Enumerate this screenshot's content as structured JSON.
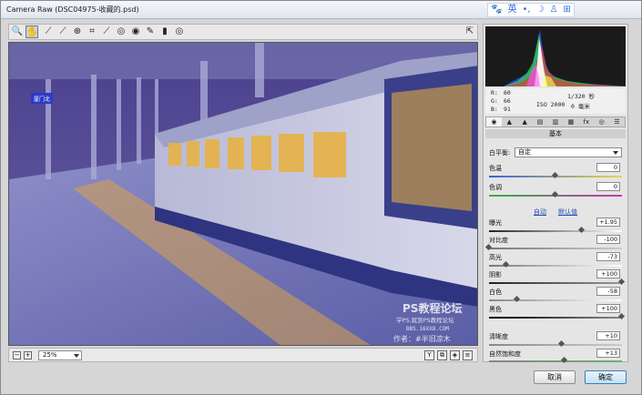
{
  "window": {
    "title": "Camera Raw (DSC04975-收藏的.psd)"
  },
  "ime": {
    "items": [
      "🐾",
      "英",
      "•,",
      "☽",
      "♙",
      "⊞"
    ]
  },
  "toolbar": {
    "tools": [
      "zoom-icon",
      "hand-icon",
      "white-balance-icon",
      "color-sampler-icon",
      "target-adjust-icon",
      "crop-icon",
      "straighten-icon",
      "spot-removal-icon",
      "red-eye-icon",
      "adjustment-brush-icon",
      "graduated-filter-icon",
      "radial-filter-icon"
    ],
    "glyphs": [
      "🔍",
      "✋",
      "⟋",
      "⟋",
      "⊕",
      "⌗",
      "⟋",
      "◎",
      "◉",
      "✎",
      "▮",
      "◎"
    ],
    "fullscreen_glyph": "⇱"
  },
  "preview": {
    "watermark_title": "PS教程论坛",
    "watermark_sub": "学PS,就到PS教程论坛",
    "watermark_url": "BBS.16XX8.COM",
    "watermark_author": "作者：#半旧凉木",
    "sign_text": "厦门北"
  },
  "bottombar": {
    "zoom_value": "25%",
    "minus": "−",
    "plus": "+",
    "view_icons": [
      "Y",
      "⧉",
      "◈",
      "≡"
    ]
  },
  "histogram": {
    "colors": {
      "red": "#ff2a2a",
      "green": "#2aff2a",
      "blue": "#3a3aff",
      "white": "#ffffff"
    }
  },
  "info": {
    "r_label": "R:",
    "r_value": "60",
    "g_label": "G:",
    "g_value": "66",
    "b_label": "B:",
    "b_value": "91",
    "shutter": "1/320 秒",
    "iso": "ISO 2000",
    "lens": "0 毫米"
  },
  "tabs": {
    "items": [
      "◉",
      "▲",
      "▲",
      "▤",
      "▥",
      "▦",
      "fx",
      "◎",
      "☰"
    ],
    "active_index": 0
  },
  "basic": {
    "panel_title": "基本",
    "wb_label": "白平衡:",
    "wb_value": "自定",
    "temp_label": "色温",
    "temp_value": "0",
    "temp_pos": 0.5,
    "tint_label": "色调",
    "tint_value": "0",
    "tint_pos": 0.5,
    "auto_link": "自动",
    "default_link": "默认值",
    "exposure_label": "曝光",
    "exposure_value": "+1.95",
    "exposure_pos": 0.7,
    "contrast_label": "对比度",
    "contrast_value": "-100",
    "contrast_pos": 0.0,
    "highlights_label": "高光",
    "highlights_value": "-73",
    "highlights_pos": 0.13,
    "shadows_label": "阴影",
    "shadows_value": "+100",
    "shadows_pos": 1.0,
    "whites_label": "白色",
    "whites_value": "-58",
    "whites_pos": 0.21,
    "blacks_label": "黑色",
    "blacks_value": "+100",
    "blacks_pos": 1.0,
    "clarity_label": "清晰度",
    "clarity_value": "+10",
    "clarity_pos": 0.55,
    "vibrance_label": "自然饱和度",
    "vibrance_value": "+13",
    "vibrance_pos": 0.57
  },
  "buttons": {
    "cancel": "取消",
    "ok": "确定"
  }
}
